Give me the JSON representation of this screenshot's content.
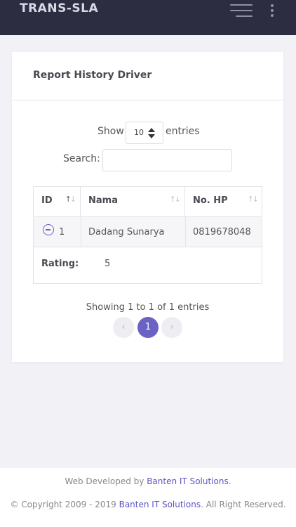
{
  "app": {
    "logo": "TRANS-SLA"
  },
  "card": {
    "title": "Report History Driver"
  },
  "length": {
    "show_label": "Show",
    "value": "10",
    "entries_label": "entries"
  },
  "search": {
    "label": "Search:",
    "value": ""
  },
  "table": {
    "columns": [
      {
        "label": "ID"
      },
      {
        "label": "Nama"
      },
      {
        "label": "No. HP"
      }
    ],
    "sort_icon": "↑↓",
    "rows": [
      {
        "id": "1",
        "nama": "Dadang Sunarya",
        "hp": "0819678048"
      }
    ],
    "child": {
      "label": "Rating:",
      "value": "5"
    }
  },
  "info": "Showing 1 to 1 of 1 entries",
  "pagination": {
    "prev": "‹",
    "current": "1",
    "next": "›"
  },
  "footer": {
    "line1_prefix": "Web Developed by ",
    "line1_link": "Banten IT Solutions",
    "line1_suffix": ".",
    "line2_prefix": "© Copyright 2009 - 2019 ",
    "line2_link": "Banten IT Solutions",
    "line2_suffix": ". All Right Reserved."
  },
  "colors": {
    "topbar": "#2c2d41",
    "accent": "#6a63c4",
    "background": "#f2f2f6"
  }
}
